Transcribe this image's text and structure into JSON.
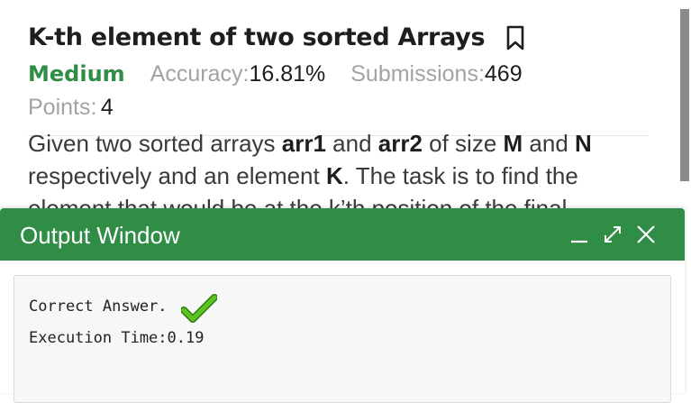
{
  "problem": {
    "title": "K-th element of two sorted Arrays",
    "difficulty": "Medium",
    "accuracy_label": "Accuracy:",
    "accuracy_value": "16.81%",
    "submissions_label": "Submissions:",
    "submissions_value": "469",
    "points_label": "Points:",
    "points_value": "4",
    "description": {
      "t1": "Given two sorted arrays ",
      "arr1": "arr1",
      "t2": " and ",
      "arr2": "arr2",
      "t3": " of size ",
      "m": "M",
      "t4": " and ",
      "n": "N",
      "t5": " respectively and an element ",
      "k": "K",
      "t6": ". The task is to find the element that would be at the k’th position of the final"
    },
    "bookmark_icon": "bookmark-icon"
  },
  "output_window": {
    "title": "Output Window",
    "controls": [
      "minimize-icon",
      "expand-icon",
      "close-icon"
    ],
    "result_text": "Correct Answer.",
    "execution_time": "Execution Time:0.19",
    "status_icon": "check-icon",
    "header_color": "#2f8d46",
    "check_color": "#4caf1f"
  },
  "colors": {
    "accent": "#2f8d46",
    "muted": "#a3a3a3",
    "text": "#1e1e1e"
  }
}
